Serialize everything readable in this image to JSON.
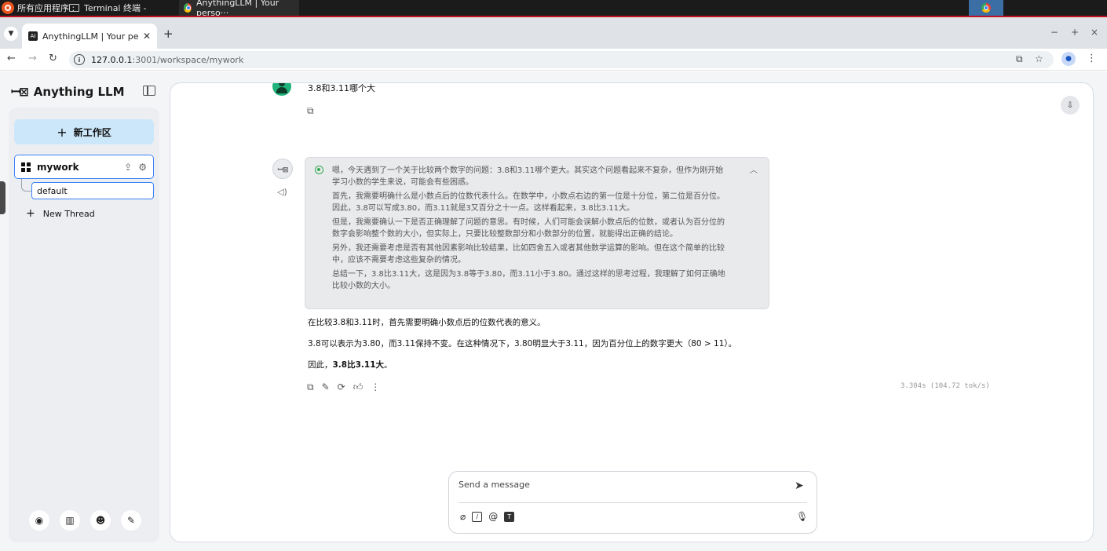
{
  "taskbar": {
    "apps_menu": "所有应用程序 :",
    "task1": "Terminal 终端 -",
    "task2": "AnythingLLM | Your perso···"
  },
  "browser": {
    "tab_title": "AnythingLLM | Your person",
    "tab_favicon": "AI",
    "url_host": "127.0.0.1",
    "url_path": ":3001/workspace/mywork",
    "window_controls": [
      "−",
      "+",
      "×"
    ]
  },
  "sidebar": {
    "brand": "Anything LLM",
    "new_workspace": "新工作区",
    "workspace": "mywork",
    "thread": "default",
    "new_thread": "New Thread",
    "footer_icons": [
      "github-icon",
      "docs-icon",
      "discord-icon",
      "wrench-icon"
    ]
  },
  "chat": {
    "user_message": "3.8和3.11哪个大",
    "thought": [
      "嗯，今天遇到了一个关于比较两个数字的问题：3.8和3.11哪个更大。其实这个问题看起来不复杂，但作为刚开始学习小数的学生来说，可能会有些困惑。",
      "首先，我需要明确什么是小数点后的位数代表什么。在数学中，小数点右边的第一位是十分位，第二位是百分位。因此，3.8可以写成3.80，而3.11就是3又百分之十一点。这样看起来，3.8比3.11大。",
      "但是，我需要确认一下是否正确理解了问题的意思。有时候，人们可能会误解小数点后的位数，或者认为百分位的数字会影响整个数的大小，但实际上，只要比较整数部分和小数部分的位置，就能得出正确的结论。",
      "另外，我还需要考虑是否有其他因素影响比较结果，比如四舍五入或者其他数学运算的影响。但在这个简单的比较中，应该不需要考虑这些复杂的情况。",
      "总结一下，3.8比3.11大，这是因为3.8等于3.80，而3.11小于3.80。通过这样的思考过程，我理解了如何正确地比较小数的大小。"
    ],
    "answer_p1": "在比较3.8和3.11时，首先需要明确小数点后的位数代表的意义。",
    "answer_p2": "3.8可以表示为3.80，而3.11保持不变。在这种情况下，3.80明显大于3.11，因为百分位上的数字更大（80 > 11）。",
    "answer_p3_prefix": "因此，",
    "answer_p3_bold": "3.8比3.11大",
    "answer_p3_suffix": "。",
    "speed": "3.304s (104.72 tok/s)",
    "composer_placeholder": "Send a message"
  },
  "colors": {
    "accent_blue": "#3b82f6",
    "new_workspace_bg": "#cde7fa",
    "user_avatar": "#20b27a",
    "taskbar_red": "#c1121f"
  }
}
